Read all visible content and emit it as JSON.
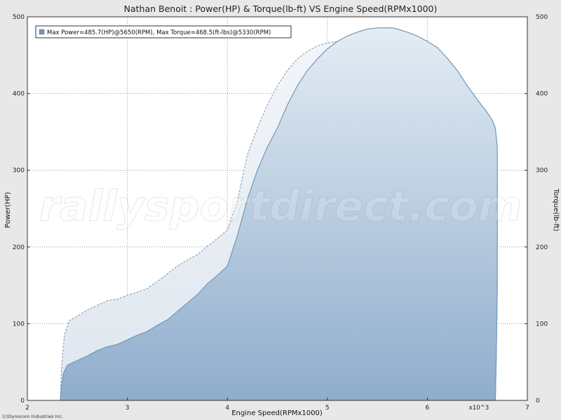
{
  "chart_data": {
    "type": "area",
    "title": "Nathan Benoit : Power(HP) & Torque(lb-ft) VS Engine Speed(RPMx1000)",
    "xlabel": "Engine Speed(RPMx1000)",
    "ylabel_left": "Power(HP)",
    "ylabel_right": "Torque(lb-ft)",
    "x_multiplier_label": "x10^3",
    "xlim": [
      2,
      7
    ],
    "ylim": [
      0,
      500
    ],
    "x_ticks": [
      2,
      3,
      4,
      5,
      6,
      7
    ],
    "x_tick_labels": [
      "2",
      "3",
      "4",
      "5",
      "6",
      "7"
    ],
    "y_ticks": [
      0,
      100,
      200,
      300,
      400,
      500
    ],
    "y_tick_labels": [
      "0",
      "100",
      "200",
      "300",
      "400",
      "500"
    ],
    "grid": true,
    "legend_text": "Max Power=485.7(HP)@5650(RPM), Max Torque=468.5(ft-lbs)@5330(RPM)",
    "legend_position": "top-left",
    "copyright": "(c)Dynocom Industries Inc.",
    "watermark": "rallysportdirect.com",
    "colors": {
      "power_line": "#6f98bb",
      "torque_line": "#7b96ad",
      "power_fill_top": "#dfe8f2",
      "power_fill_bottom": "#91b0cf",
      "torque_fill": "#e9eef5",
      "plot_bg": "#ffffff",
      "grid": "#999999"
    },
    "series": [
      {
        "name": "Power(HP)",
        "x": [
          2.33,
          2.34,
          2.36,
          2.4,
          2.5,
          2.6,
          2.7,
          2.8,
          2.9,
          3.0,
          3.1,
          3.2,
          3.3,
          3.4,
          3.5,
          3.6,
          3.7,
          3.8,
          3.9,
          4.0,
          4.1,
          4.2,
          4.3,
          4.4,
          4.5,
          4.6,
          4.7,
          4.8,
          4.9,
          5.0,
          5.1,
          5.2,
          5.3,
          5.4,
          5.5,
          5.6,
          5.65,
          5.7,
          5.8,
          5.9,
          6.0,
          6.1,
          6.2,
          6.3,
          6.4,
          6.5,
          6.6,
          6.65,
          6.68,
          6.7,
          6.7,
          6.7,
          6.69,
          6.68
        ],
        "y": [
          0,
          18,
          35,
          46,
          52,
          58,
          65,
          70,
          73,
          79,
          85,
          90,
          98,
          105,
          116,
          127,
          138,
          152,
          163,
          175,
          215,
          262,
          300,
          330,
          355,
          385,
          410,
          430,
          445,
          458,
          468,
          475,
          480,
          484,
          485.5,
          485.7,
          485.5,
          484,
          480,
          475,
          468,
          460,
          446,
          430,
          410,
          392,
          375,
          365,
          355,
          330,
          250,
          150,
          60,
          0
        ]
      },
      {
        "name": "Torque(lb-ft)",
        "x": [
          2.33,
          2.34,
          2.37,
          2.42,
          2.5,
          2.6,
          2.7,
          2.8,
          2.9,
          3.0,
          3.1,
          3.2,
          3.3,
          3.4,
          3.5,
          3.6,
          3.7,
          3.8,
          3.9,
          4.0,
          4.1,
          4.2,
          4.3,
          4.4,
          4.5,
          4.6,
          4.7,
          4.8,
          4.9,
          5.0,
          5.1,
          5.2,
          5.33,
          5.4,
          5.5,
          5.6,
          5.7,
          5.8,
          5.9,
          6.0,
          6.1,
          6.2,
          6.3,
          6.4,
          6.5,
          6.55,
          6.6,
          6.65,
          6.68,
          6.7,
          6.7,
          6.7,
          6.69,
          6.68
        ],
        "y": [
          0,
          40,
          85,
          104,
          110,
          118,
          124,
          130,
          132,
          137,
          141,
          146,
          155,
          165,
          175,
          183,
          190,
          201,
          211,
          222,
          260,
          320,
          355,
          385,
          410,
          430,
          445,
          455,
          462,
          466,
          468,
          468.4,
          468.5,
          467,
          462,
          455,
          445,
          432,
          420,
          410,
          398,
          380,
          360,
          340,
          320,
          315,
          306,
          300,
          292,
          280,
          230,
          140,
          60,
          0
        ]
      }
    ]
  }
}
